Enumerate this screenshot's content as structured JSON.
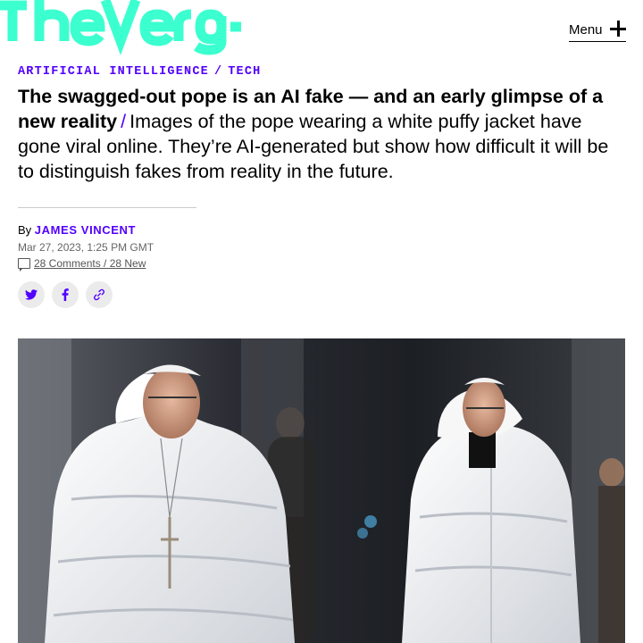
{
  "site": {
    "logo_text": "The Verge",
    "menu_label": "Menu"
  },
  "article": {
    "categories": [
      "ARTIFICIAL INTELLIGENCE",
      "TECH"
    ],
    "category_separator": "/",
    "title": "The swagged-out pope is an AI fake — and an early glimpse of a new reality",
    "title_separator": "/",
    "dek": "Images of the pope wearing a white puffy jacket have gone viral online. They’re AI-generated but show how difficult it will be to distinguish fakes from reality in the future.",
    "byline_prefix": "By",
    "author": "JAMES VINCENT",
    "date": "Mar 27, 2023, 1:25 PM GMT",
    "comments_text": "28 Comments / 28 New"
  },
  "share": {
    "icons": [
      "twitter-icon",
      "facebook-icon",
      "link-icon"
    ]
  },
  "colors": {
    "brand_teal": "#3cffd0",
    "accent_purple": "#5200ff"
  }
}
